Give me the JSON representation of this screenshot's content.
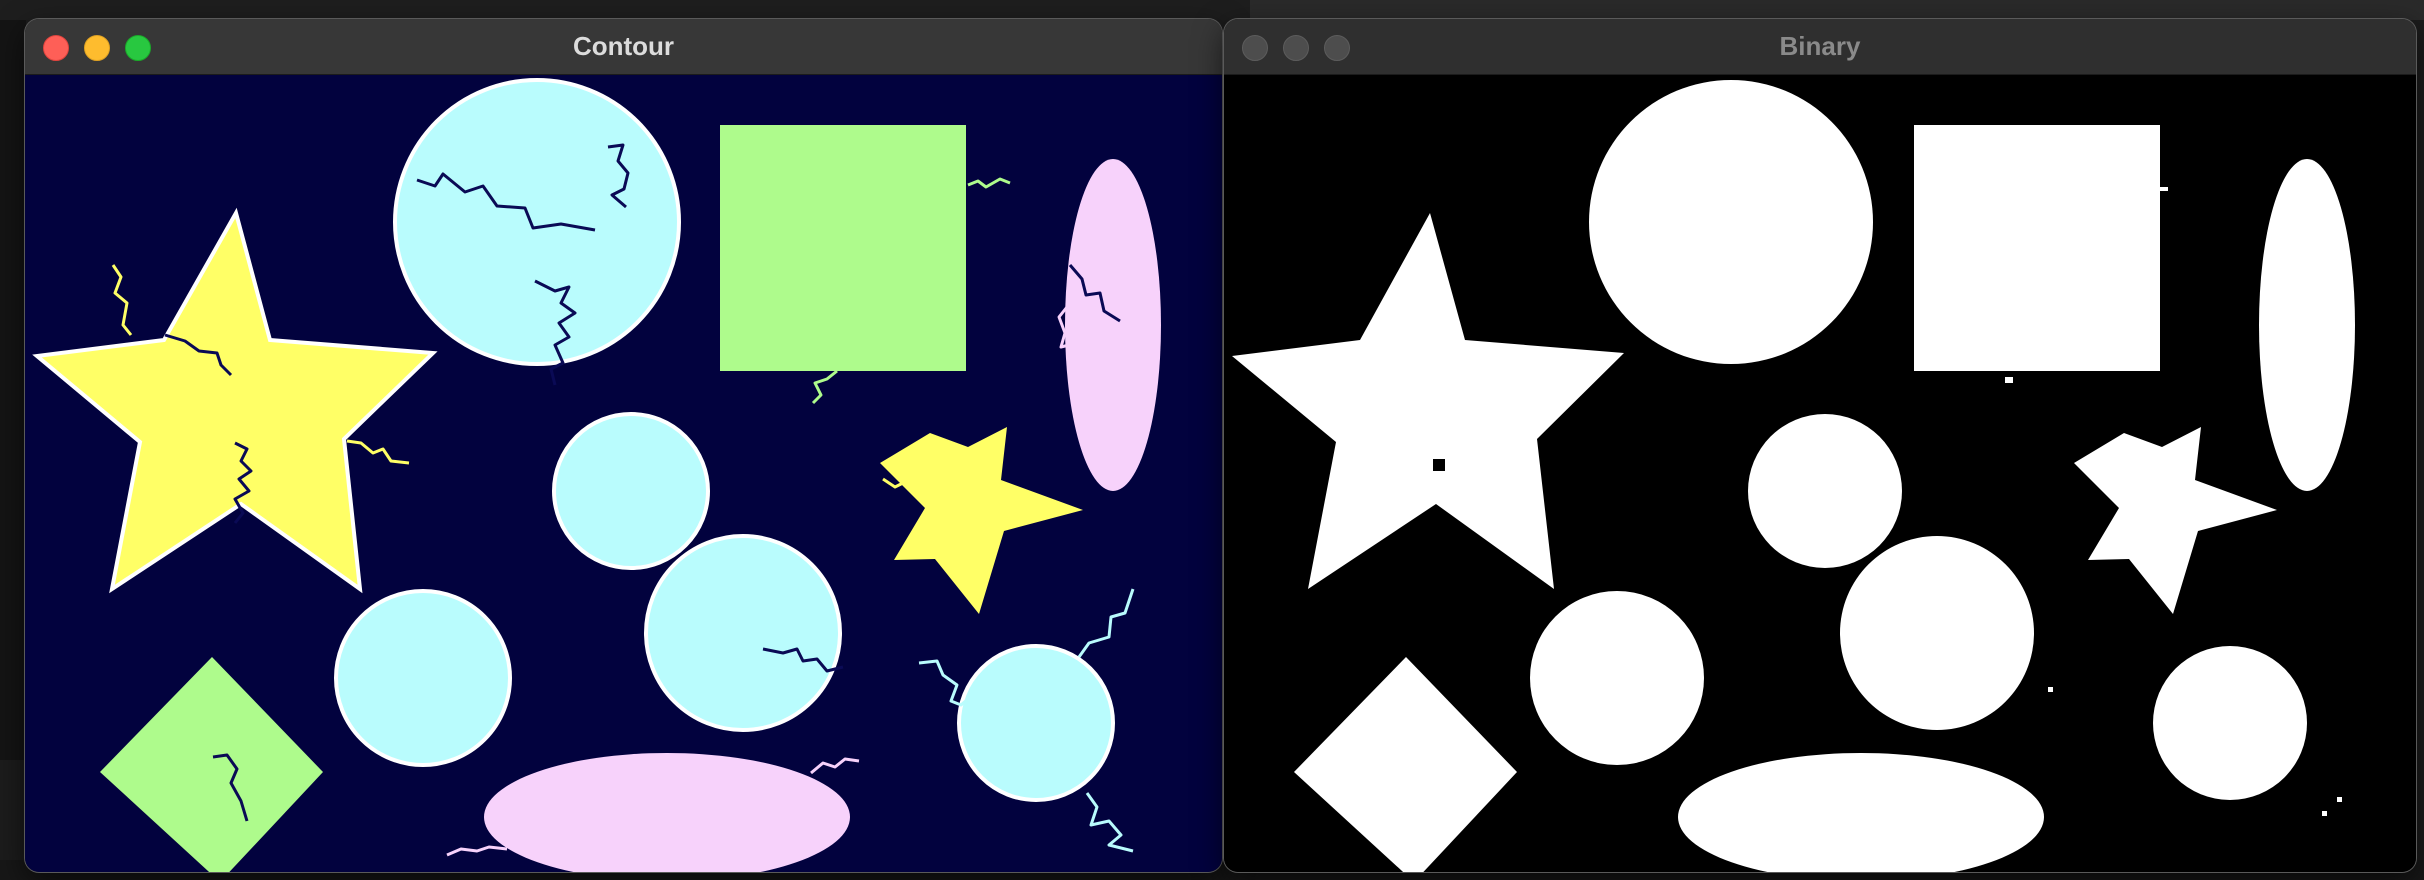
{
  "windows": {
    "contour": {
      "title": "Contour",
      "background_color": "#02023e",
      "shape_colors": {
        "yellow": "#ffff66",
        "cyan": "#b9fcfd",
        "green": "#aefb8c",
        "pink": "#f7d2fb",
        "contour": "#ffffff",
        "noise_dark": "#0a0a55"
      }
    },
    "binary": {
      "title": "Binary",
      "background_color": "#000000",
      "foreground_color": "#ffffff"
    }
  },
  "window_controls": {
    "close_icon": "red-circle",
    "minimize_icon": "yellow-circle",
    "zoom_icon": "green-circle",
    "inactive_icon": "gray-circle"
  }
}
